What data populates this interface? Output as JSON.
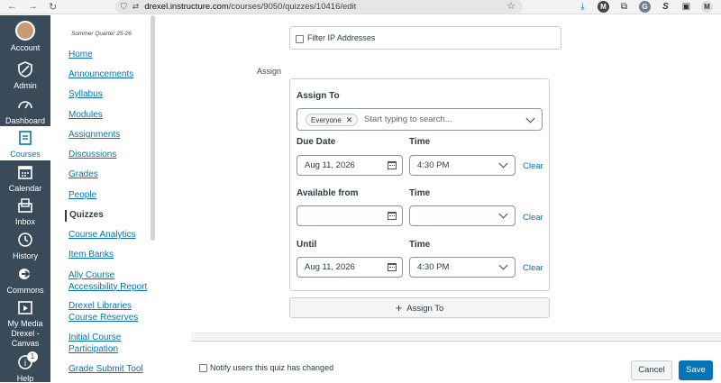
{
  "browser": {
    "url_domain": "drexel.instructure.com",
    "url_path": "/courses/9050/quizzes/10416/edit"
  },
  "global_nav": [
    {
      "label": "Account",
      "icon": "avatar"
    },
    {
      "label": "Admin",
      "icon": "shield-icon"
    },
    {
      "label": "Dashboard",
      "icon": "dashboard-icon"
    },
    {
      "label": "Courses",
      "icon": "book-icon"
    },
    {
      "label": "Calendar",
      "icon": "calendar-icon"
    },
    {
      "label": "Inbox",
      "icon": "inbox-icon"
    },
    {
      "label": "History",
      "icon": "clock-icon"
    },
    {
      "label": "Commons",
      "icon": "commons-icon"
    },
    {
      "label": "My Media Drexel - Canvas",
      "icon": "media-icon"
    },
    {
      "label": "Help",
      "icon": "help-icon",
      "badge": "1"
    }
  ],
  "course_nav": {
    "term": "Summer Quarter 25-26",
    "items": [
      "Home",
      "Announcements",
      "Syllabus",
      "Modules",
      "Assignments",
      "Discussions",
      "Grades",
      "People",
      "Quizzes",
      "Course Analytics",
      "Item Banks",
      "Ally Course Accessibility Report",
      "Drexel Libraries Course Reserves",
      "Initial Course Participation",
      "Grade Submit Tool"
    ],
    "active": "Quizzes"
  },
  "filter_ip": {
    "label": "Filter IP Addresses",
    "checked": false
  },
  "assign": {
    "section_label": "Assign",
    "assign_to_label": "Assign To",
    "chip": "Everyone",
    "placeholder": "Start typing to search...",
    "due_label": "Due Date",
    "time_label": "Time",
    "due_date": "Aug 11, 2026",
    "due_time": "4:30 PM",
    "available_label": "Available from",
    "available_date": "",
    "available_time": "",
    "until_label": "Until",
    "until_date": "Aug 11, 2026",
    "until_time": "4:30 PM",
    "clear_label": "Clear",
    "add_button": "Assign To"
  },
  "footer": {
    "notify_label": "Notify users this quiz has changed",
    "cancel": "Cancel",
    "save": "Save"
  },
  "colors": {
    "nav_bg": "#394b58",
    "link": "#0374b5",
    "primary": "#0374b5"
  }
}
